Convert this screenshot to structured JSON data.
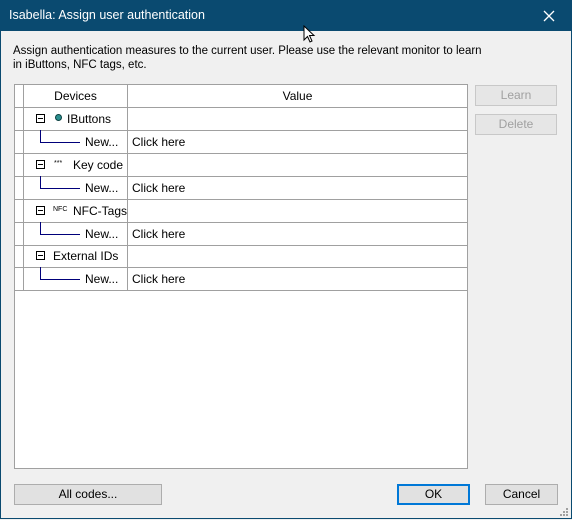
{
  "window": {
    "title": "Isabella: Assign user authentication"
  },
  "description": "Assign authentication measures to the current user. Please use the relevant monitor to learn in iButtons, NFC tags, etc.",
  "grid": {
    "columns": [
      "Devices",
      "Value"
    ],
    "groups": [
      {
        "label": "IButtons",
        "icon": "ibutton-icon",
        "child_label": "New...",
        "child_value": "Click here"
      },
      {
        "label": "Key code",
        "icon": "key-code-icon",
        "icon_text": "***",
        "child_label": "New...",
        "child_value": "Click here"
      },
      {
        "label": "NFC-Tags",
        "icon": "nfc-icon",
        "icon_text": "NFC",
        "child_label": "New...",
        "child_value": "Click here"
      },
      {
        "label": "External IDs",
        "icon": "",
        "child_label": "New...",
        "child_value": "Click here"
      }
    ]
  },
  "buttons": {
    "learn": "Learn",
    "delete": "Delete",
    "all_codes": "All codes...",
    "ok": "OK",
    "cancel": "Cancel"
  },
  "colors": {
    "titlebar": "#0a4a70",
    "tree_line": "#00007a",
    "ibutton": "#2b8f8f"
  }
}
